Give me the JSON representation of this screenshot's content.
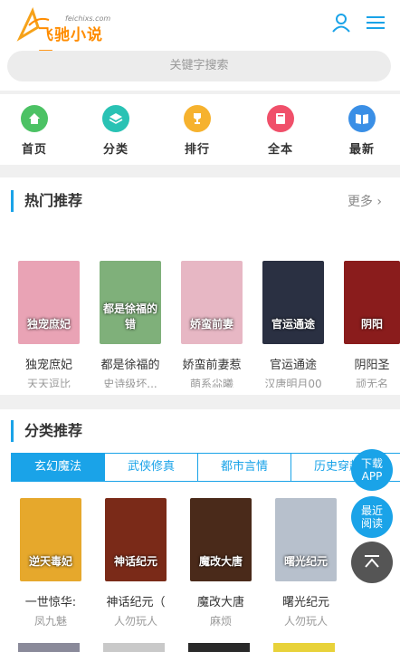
{
  "header": {
    "brand": "飞驰小说网",
    "domain": "feichixs.com",
    "user_icon": "user-icon",
    "menu_icon": "menu-icon"
  },
  "search": {
    "placeholder": "关键字搜索"
  },
  "nav": [
    {
      "label": "首页",
      "icon": "home-icon",
      "color": "#4cc264"
    },
    {
      "label": "分类",
      "icon": "layers-icon",
      "color": "#29c2b4"
    },
    {
      "label": "排行",
      "icon": "trophy-icon",
      "color": "#f6b22e"
    },
    {
      "label": "全本",
      "icon": "book-icon",
      "color": "#f0506a"
    },
    {
      "label": "最新",
      "icon": "open-book-icon",
      "color": "#3a8fe6"
    }
  ],
  "hot": {
    "title": "热门推荐",
    "more": "更多",
    "books": [
      {
        "name": "独宠庶妃",
        "author": "天天逗比",
        "cover_text": "独宠庶妃",
        "color": "#e9a3b5"
      },
      {
        "name": "都是徐福的",
        "author": "史诗级坏...",
        "cover_text": "都是徐福的错",
        "color": "#7fb07a"
      },
      {
        "name": "娇蛮前妻惹",
        "author": "萌系尛曦",
        "cover_text": "娇蛮前妻",
        "color": "#e7b7c4"
      },
      {
        "name": "官运通途",
        "author": "汉唐明月00",
        "cover_text": "官运通途",
        "color": "#2a3042"
      },
      {
        "name": "阴阳圣",
        "author": "顽无名",
        "cover_text": "阴阳",
        "color": "#8a1c1c"
      }
    ]
  },
  "category": {
    "title": "分类推荐",
    "tabs": [
      "玄幻魔法",
      "武侠修真",
      "都市言情",
      "历史穿越"
    ],
    "books": [
      {
        "name": "一世惊华:",
        "author": "凤九魅",
        "cover_text": "逆天毒妃",
        "color": "#e6a82c"
      },
      {
        "name": "神话纪元（",
        "author": "人勿玩人",
        "cover_text": "神话纪元",
        "color": "#7a2a18"
      },
      {
        "name": "魔改大唐",
        "author": "麻烦",
        "cover_text": "魔改大唐",
        "color": "#4a2a1a"
      },
      {
        "name": "曙光纪元",
        "author": "人勿玩人",
        "cover_text": "曙光纪元",
        "color": "#b7c0cc"
      }
    ]
  },
  "floats": {
    "download": "下载APP",
    "recent": "最近阅读"
  }
}
